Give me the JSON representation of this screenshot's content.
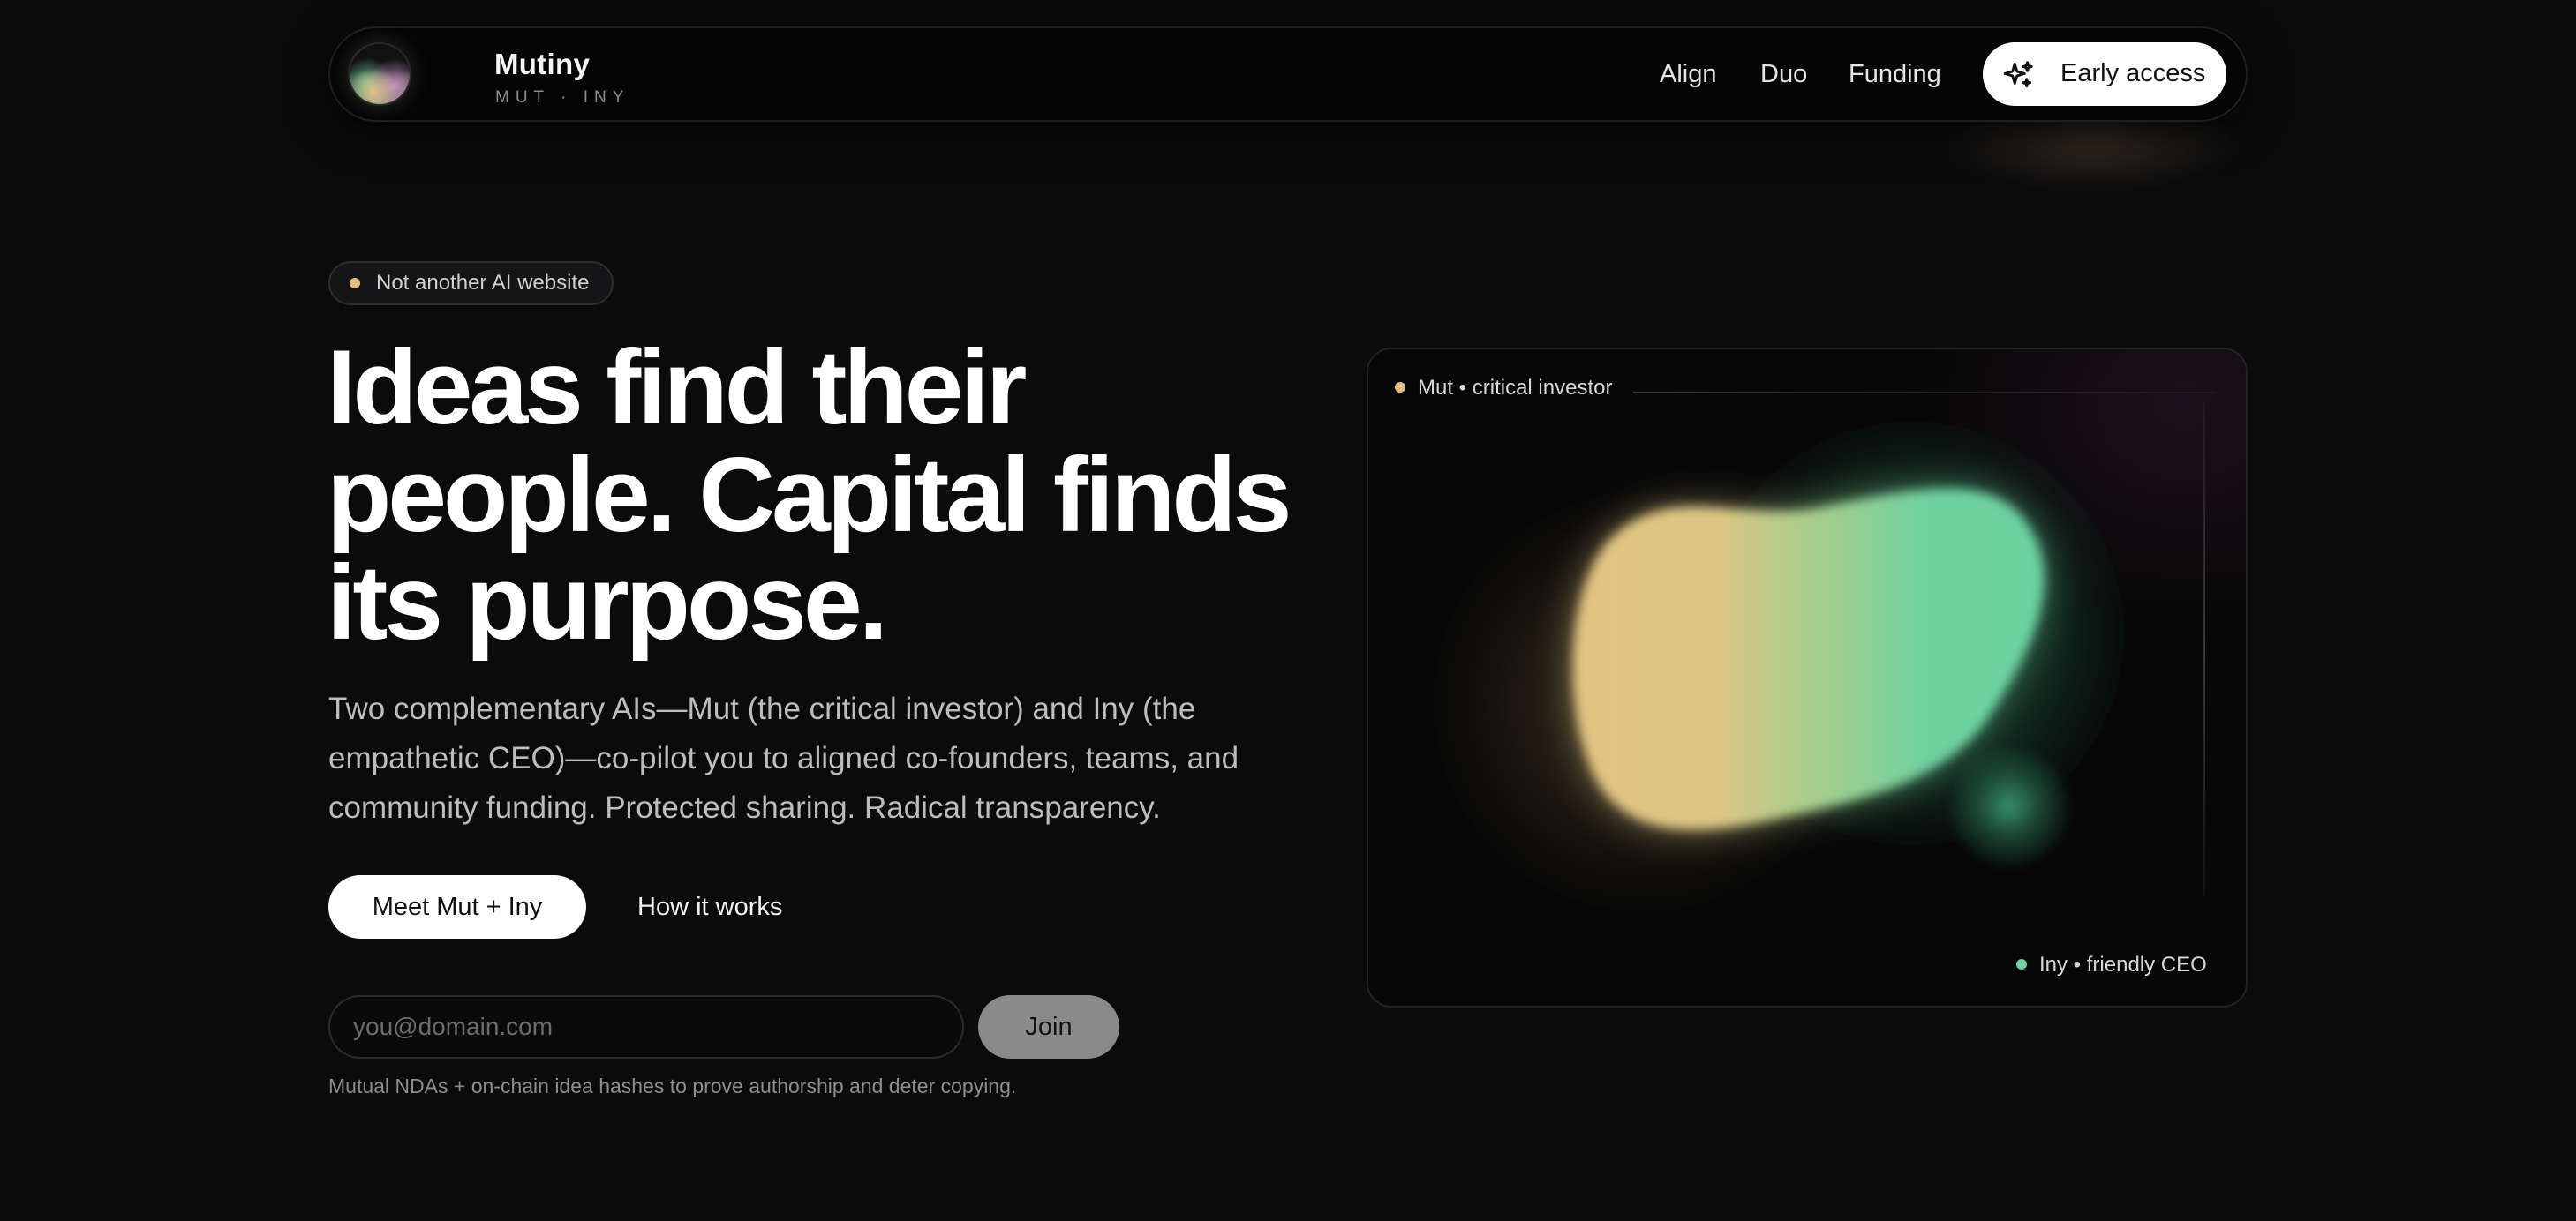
{
  "nav": {
    "brand_name": "Mutiny",
    "brand_sub": "MUT · INY",
    "links": [
      {
        "label": "Align"
      },
      {
        "label": "Duo"
      },
      {
        "label": "Funding"
      }
    ],
    "cta_label": "Early access",
    "cta_icon": "sparkles-icon"
  },
  "hero": {
    "tag": "Not another AI website",
    "headline_lines": [
      "Ideas find their",
      "people. Capital finds",
      "its purpose."
    ],
    "lede": "Two complementary AIs—Mut (the critical investor) and Iny (the empathetic CEO)—co-pilot you to aligned co-founders, teams, and community funding. Protected sharing. Radical transparency.",
    "primary_button": "Meet Mut + Iny",
    "secondary_link": "How it works",
    "email_placeholder": "you@domain.com",
    "join_button": "Join",
    "fine_print": "Mutual NDAs + on-chain idea hashes to prove authorship and deter copying."
  },
  "visual": {
    "mut_label": "Mut • critical investor",
    "iny_label": "Iny • friendly CEO"
  },
  "colors": {
    "background": "#0b0b0c",
    "accent_gold": "#e3c07e",
    "accent_green": "#6dd3a0",
    "text_primary": "#ffffff",
    "text_muted": "#bdbdbd"
  }
}
